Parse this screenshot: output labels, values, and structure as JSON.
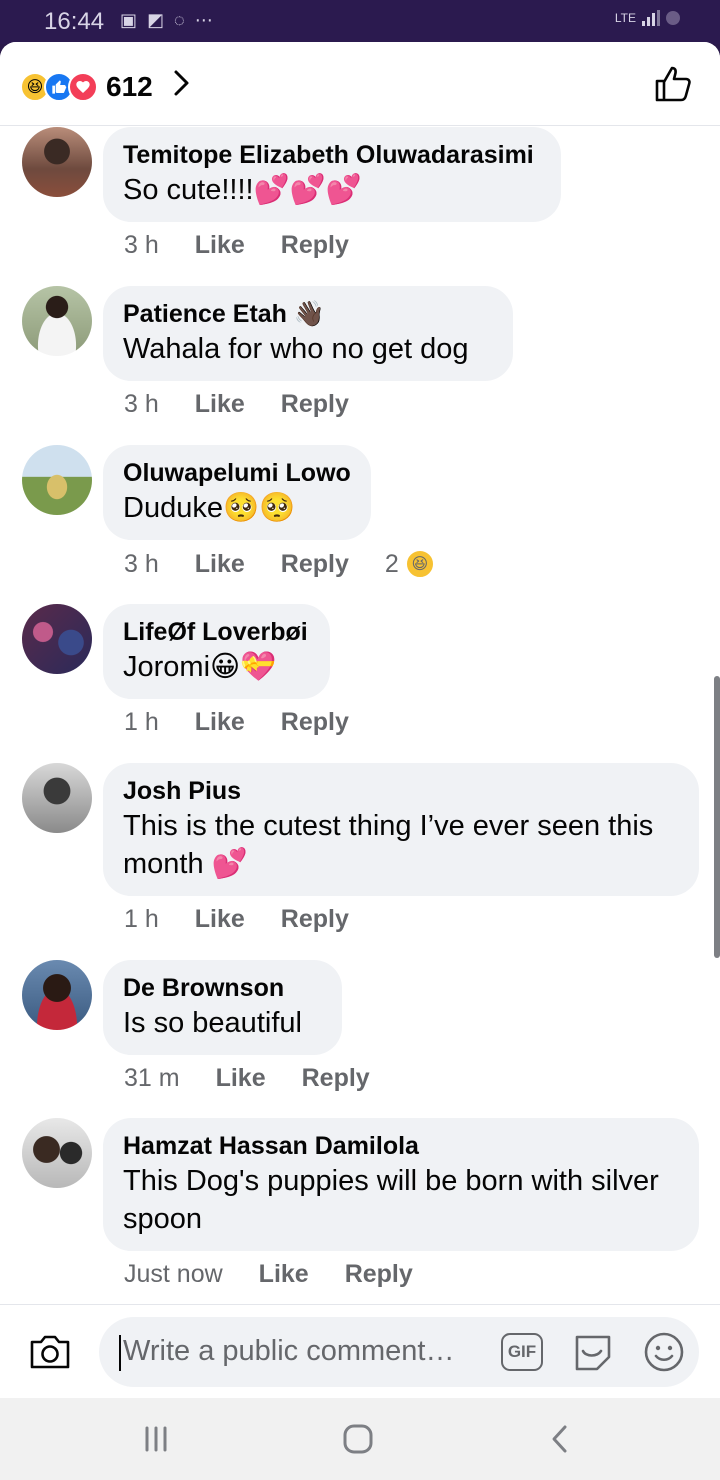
{
  "status_bar": {
    "time": "16:44",
    "network": "LTE"
  },
  "header": {
    "reaction_count": "612"
  },
  "comments": [
    {
      "author": "Temitope Elizabeth Oluwadarasimi",
      "text": "So cute!!!!💕💕💕",
      "time": "3 h",
      "like": "Like",
      "reply": "Reply"
    },
    {
      "author": "Patience Etah 👋🏿",
      "text": "Wahala for who no get dog",
      "time": "3 h",
      "like": "Like",
      "reply": "Reply"
    },
    {
      "author": "Oluwapelumi Lowo",
      "text": "Duduke🥺🥺",
      "time": "3 h",
      "like": "Like",
      "reply": "Reply",
      "reaction_count": "2"
    },
    {
      "author": "LifeØf Loverbøi",
      "text": "Joromi😀💝",
      "time": "1 h",
      "like": "Like",
      "reply": "Reply"
    },
    {
      "author": "Josh Pius",
      "text": "This is the cutest thing I’ve ever seen this month 💕",
      "time": "1 h",
      "like": "Like",
      "reply": "Reply"
    },
    {
      "author": "De Brownson",
      "text": "Is so beautiful",
      "time": "31 m",
      "like": "Like",
      "reply": "Reply"
    },
    {
      "author": "Hamzat Hassan Damilola",
      "text": "This Dog's puppies will be born with silver spoon",
      "time": "Just now",
      "like": "Like",
      "reply": "Reply"
    }
  ],
  "composer": {
    "placeholder": "Write a public comment…",
    "gif_label": "GIF"
  },
  "icons": {
    "like": "thumbs-up-icon",
    "camera": "camera-icon",
    "gif": "gif-icon",
    "sticker": "sticker-icon",
    "emoji": "smiley-icon",
    "nav": [
      "recents-icon",
      "home-icon",
      "back-icon"
    ]
  },
  "colors": {
    "accent": "#1877f2",
    "love": "#f33e58",
    "haha": "#f7c232",
    "bubble": "#f0f2f5",
    "secondary_text": "#65676b"
  }
}
